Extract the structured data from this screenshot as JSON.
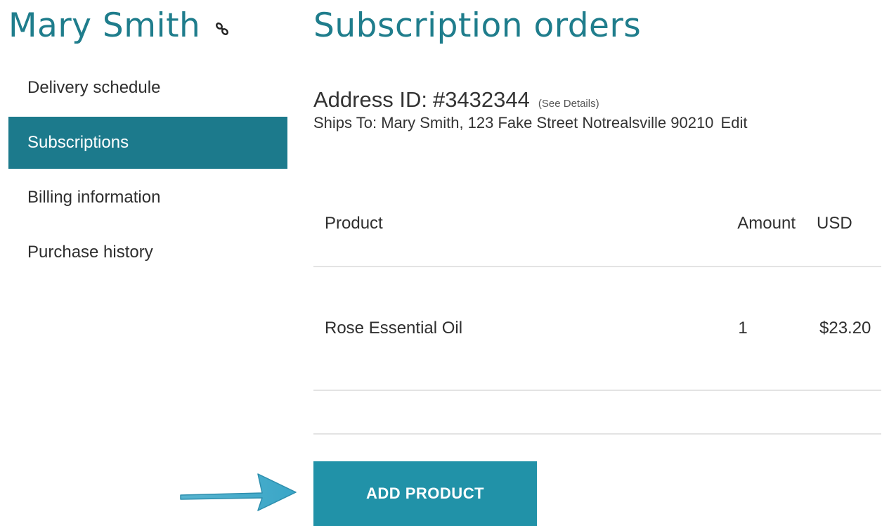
{
  "user": {
    "name": "Mary Smith",
    "link_icon": "link-icon"
  },
  "sidebar": {
    "items": [
      {
        "label": "Delivery schedule",
        "active": false
      },
      {
        "label": "Subscriptions",
        "active": true
      },
      {
        "label": "Billing information",
        "active": false
      },
      {
        "label": "Purchase history",
        "active": false
      }
    ]
  },
  "page": {
    "title": "Subscription orders"
  },
  "address": {
    "label": "Address ID:",
    "id": "#3432344",
    "see_details": "(See Details)",
    "ships_to": "Ships To: Mary Smith, 123 Fake Street Notrealsville 90210",
    "edit": "Edit"
  },
  "table": {
    "headers": {
      "product": "Product",
      "amount": "Amount",
      "usd": "USD"
    },
    "rows": [
      {
        "product": "Rose Essential Oil",
        "amount": "1",
        "usd": "$23.20"
      }
    ]
  },
  "actions": {
    "add_product": "ADD PRODUCT"
  },
  "annotation": {
    "arrow_icon": "arrow-right-icon",
    "arrow_color": "#3aa6c7"
  },
  "colors": {
    "accent": "#1f7d8c",
    "sidebar_active_bg": "#1c7a8c",
    "button_bg": "#2192a8",
    "divider": "#e3e3e3"
  }
}
